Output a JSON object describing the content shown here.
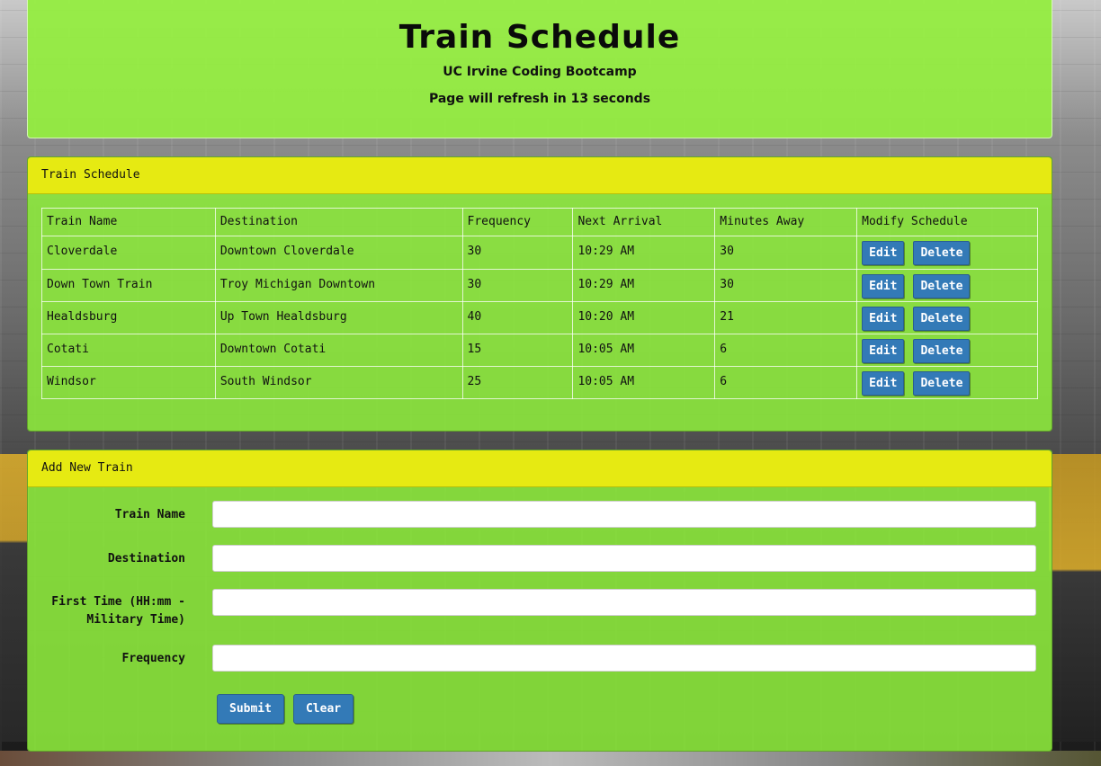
{
  "header": {
    "title": "Train Schedule",
    "subtitle": "UC Irvine Coding Bootcamp",
    "refresh_text": "Page will refresh in 13 seconds"
  },
  "schedule_panel": {
    "heading": "Train Schedule",
    "columns": [
      "Train Name",
      "Destination",
      "Frequency",
      "Next Arrival",
      "Minutes Away",
      "Modify Schedule"
    ],
    "rows": [
      {
        "name": "Cloverdale",
        "destination": "Downtown Cloverdale",
        "frequency": "30",
        "next": "10:29 AM",
        "away": "30"
      },
      {
        "name": "Down Town Train",
        "destination": "Troy Michigan Downtown",
        "frequency": "30",
        "next": "10:29 AM",
        "away": "30"
      },
      {
        "name": "Healdsburg",
        "destination": "Up Town Healdsburg",
        "frequency": "40",
        "next": "10:20 AM",
        "away": "21"
      },
      {
        "name": "Cotati",
        "destination": "Downtown Cotati",
        "frequency": "15",
        "next": "10:05 AM",
        "away": "6"
      },
      {
        "name": "Windsor",
        "destination": "South Windsor",
        "frequency": "25",
        "next": "10:05 AM",
        "away": "6"
      }
    ],
    "edit_label": "Edit",
    "delete_label": "Delete"
  },
  "add_panel": {
    "heading": "Add New Train",
    "fields": {
      "train_name": {
        "label": "Train Name",
        "value": ""
      },
      "destination": {
        "label": "Destination",
        "value": ""
      },
      "first_time": {
        "label": "First Time (HH:mm - Military Time)",
        "value": ""
      },
      "frequency": {
        "label": "Frequency",
        "value": ""
      }
    },
    "submit_label": "Submit",
    "clear_label": "Clear"
  },
  "colors": {
    "panel_green": "#8ce83c",
    "heading_yellow": "#e6ea12",
    "button_blue": "#337ab7"
  }
}
